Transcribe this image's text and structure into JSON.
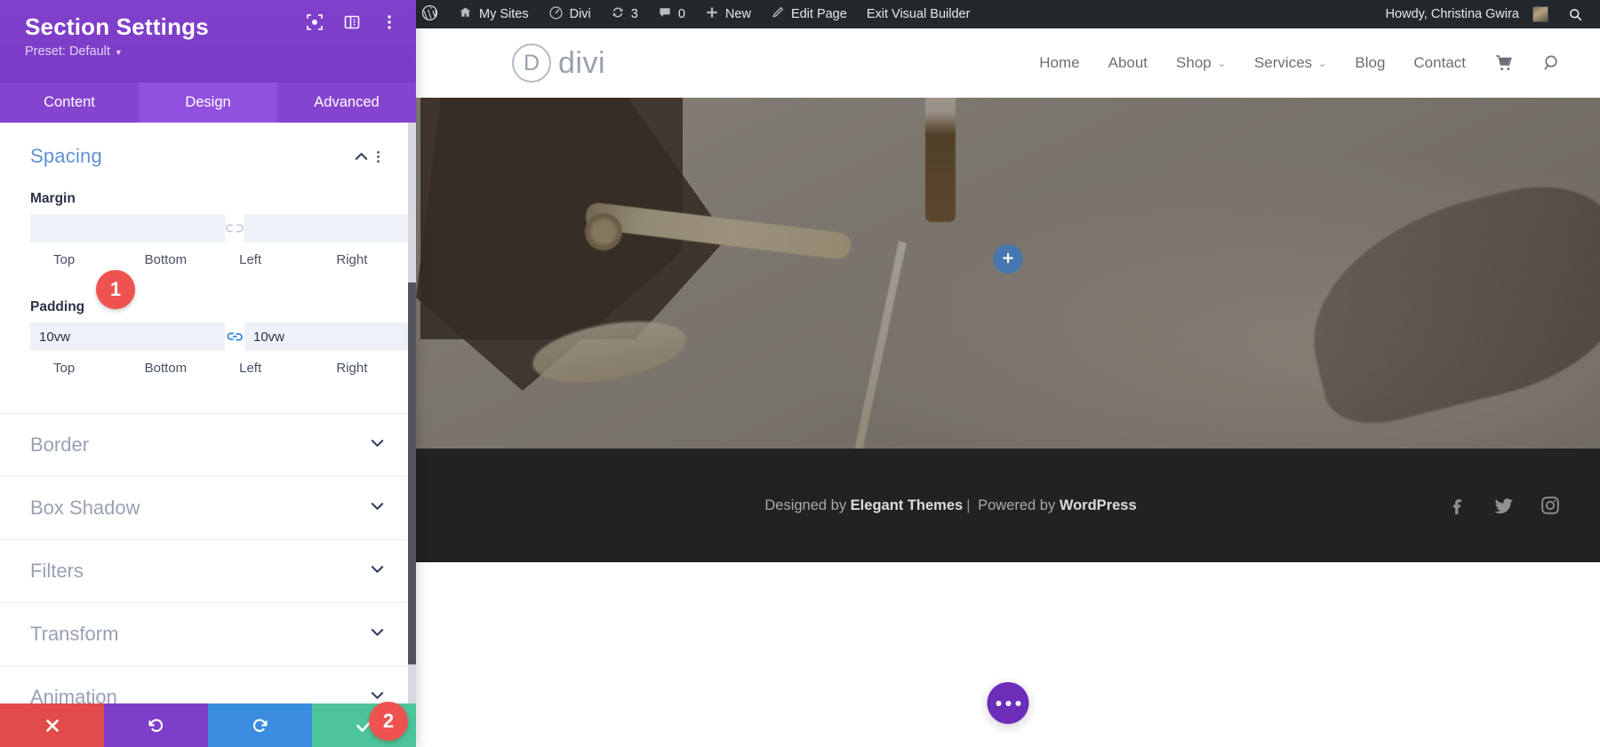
{
  "panel": {
    "title": "Section Settings",
    "preset_label": "Preset: Default",
    "header_icons": [
      {
        "name": "focus-target-icon"
      },
      {
        "name": "panel-layout-icon"
      },
      {
        "name": "more-options-icon"
      }
    ],
    "tabs": [
      {
        "label": "Content",
        "active": false
      },
      {
        "label": "Design",
        "active": true
      },
      {
        "label": "Advanced",
        "active": false
      }
    ],
    "spacing": {
      "title": "Spacing",
      "margin": {
        "label": "Margin",
        "values": {
          "top": "",
          "bottom": "",
          "left": "",
          "right": ""
        },
        "placeholders": {
          "top": "",
          "bottom": "",
          "left": "",
          "right": ""
        },
        "linked_left_pair": false,
        "linked_right_pair": false
      },
      "padding": {
        "label": "Padding",
        "values": {
          "top": "10vw",
          "bottom": "10vw",
          "left": "",
          "right": ""
        },
        "placeholders": {
          "top": "",
          "bottom": "",
          "left": "",
          "right": ""
        },
        "linked_left_pair": true,
        "linked_right_pair": false
      },
      "column_labels": [
        "Top",
        "Bottom",
        "Left",
        "Right"
      ]
    },
    "collapsed_sections": [
      {
        "label": "Border"
      },
      {
        "label": "Box Shadow"
      },
      {
        "label": "Filters"
      },
      {
        "label": "Transform"
      },
      {
        "label": "Animation"
      }
    ],
    "actions": [
      {
        "name": "cancel-button",
        "icon": "close-icon",
        "color": "#e24b4b"
      },
      {
        "name": "undo-button",
        "icon": "undo-icon",
        "color": "#7d3ec8"
      },
      {
        "name": "redo-button",
        "icon": "redo-icon",
        "color": "#3a8dde"
      },
      {
        "name": "save-button",
        "icon": "check-icon",
        "color": "#4ec49a"
      }
    ]
  },
  "callouts": [
    {
      "number": "1",
      "target": "padding-label"
    },
    {
      "number": "2",
      "target": "save-button"
    }
  ],
  "adminbar": {
    "items": [
      {
        "label": "",
        "icon": "wordpress-logo-icon"
      },
      {
        "label": "My Sites",
        "icon": "sites-icon"
      },
      {
        "label": "Divi",
        "icon": "divi-dashboard-icon"
      },
      {
        "label": "3",
        "icon": "updates-icon"
      },
      {
        "label": "0",
        "icon": "comments-icon"
      },
      {
        "label": "New",
        "icon": "plus-icon"
      },
      {
        "label": "Edit Page",
        "icon": "pencil-icon"
      },
      {
        "label": "Exit Visual Builder",
        "icon": ""
      }
    ],
    "howdy": "Howdy, Christina Gwira",
    "search_icon": "search-icon"
  },
  "site": {
    "logo": {
      "mark": "D",
      "word": "divi"
    },
    "nav": [
      {
        "label": "Home",
        "has_dropdown": false
      },
      {
        "label": "About",
        "has_dropdown": false
      },
      {
        "label": "Shop",
        "has_dropdown": true
      },
      {
        "label": "Services",
        "has_dropdown": true
      },
      {
        "label": "Blog",
        "has_dropdown": false
      },
      {
        "label": "Contact",
        "has_dropdown": false
      }
    ],
    "nav_icons": [
      {
        "name": "cart-icon"
      },
      {
        "name": "search-icon"
      }
    ],
    "hero": {
      "add_button_icon": "plus-icon"
    },
    "footer": {
      "prefix": "Designed by ",
      "brand1": "Elegant Themes",
      "separator": "|",
      "middle": " Powered by ",
      "brand2": "WordPress",
      "social": [
        {
          "name": "facebook-icon"
        },
        {
          "name": "twitter-icon"
        },
        {
          "name": "instagram-icon"
        }
      ]
    },
    "fab": {
      "name": "builder-menu-button",
      "icon": "ellipsis-icon"
    }
  },
  "colors": {
    "panel_purple": "#7d3ec8",
    "tab_active": "#9150e0",
    "accent_blue": "#5f8fd4",
    "badge_red": "#ef5350",
    "save_green": "#4ec49a",
    "adminbar_dark": "#23282d",
    "footer_dark": "#222222"
  }
}
